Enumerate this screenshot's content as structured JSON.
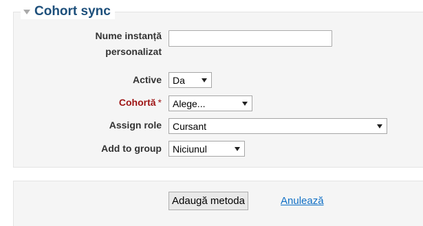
{
  "section": {
    "title": "Cohort sync"
  },
  "fields": {
    "instance_name": {
      "label_line1": "Nume instanță",
      "label_line2": "personalizat",
      "value": ""
    },
    "active": {
      "label": "Active",
      "selected": "Da"
    },
    "cohort": {
      "label": "Cohortă",
      "required_marker": "*",
      "selected": "Alege..."
    },
    "assign_role": {
      "label": "Assign role",
      "selected": "Cursant"
    },
    "add_to_group": {
      "label": "Add to group",
      "selected": "Niciunul"
    }
  },
  "actions": {
    "submit_label": "Adaugă metoda",
    "cancel_label": "Anulează"
  },
  "colors": {
    "legend": "#1d4f7b",
    "required": "#9e1414",
    "link": "#0f6fc5",
    "panel_bg": "#f5f5f5"
  },
  "icons": {
    "collapse": "collapse-triangle-icon",
    "dropdown": "chevron-down-icon"
  }
}
